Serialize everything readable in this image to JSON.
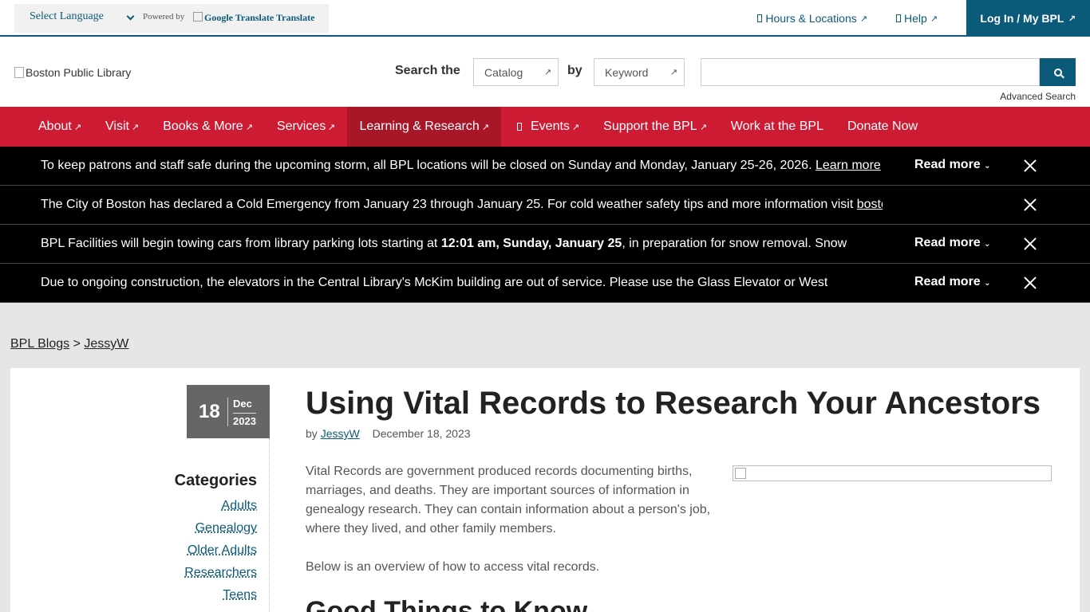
{
  "translate": {
    "select_label": "Select Language",
    "powered_by": "Powered by",
    "google_translate": "Google Translate",
    "translate": "Translate"
  },
  "toplinks": {
    "hours": "Hours & Locations",
    "help": "Help",
    "login": "Log In / My BPL"
  },
  "header": {
    "logo_alt": "Boston Public Library",
    "search_the": "Search the",
    "catalog": "Catalog",
    "by": "by",
    "keyword": "Keyword",
    "search_placeholder": "",
    "advanced": "Advanced Search"
  },
  "nav": [
    {
      "label": "About"
    },
    {
      "label": "Visit"
    },
    {
      "label": "Books & More"
    },
    {
      "label": "Services"
    },
    {
      "label": "Learning & Research"
    },
    {
      "label": "Events"
    },
    {
      "label": "Support the BPL"
    },
    {
      "label": "Work at the BPL"
    },
    {
      "label": "Donate Now"
    }
  ],
  "alerts": {
    "a1": {
      "text": "To keep patrons and staff safe during the upcoming storm, all BPL locations will be closed on Sunday and Monday, January 25-26, 2026. ",
      "link": "Learn more",
      "more": "Read more"
    },
    "a2": {
      "text": "The City of Boston has declared a Cold Emergency from January 23 through January 25. For cold weather safety tips and more information visit ",
      "link": "boston.gov/cold"
    },
    "a3": {
      "text_before": "BPL Facilities will begin towing cars from library parking lots starting at ",
      "bold": "12:01 am, Sunday, January 25",
      "text_after": ", in preparation for snow removal. Snow",
      "more": "Read more"
    },
    "a4": {
      "text": "Due to ongoing construction, the elevators in the Central Library's McKim building are out of service. Please use the Glass Elevator or West",
      "more": "Read more"
    }
  },
  "breadcrumb": {
    "root": "BPL Blogs",
    "sep": ">",
    "current": "JessyW"
  },
  "post": {
    "day": "18",
    "month": "Dec",
    "year": "2023",
    "title": "Using Vital Records to Research Your Ancestors",
    "by": "by",
    "author": "JessyW",
    "date": "December 18, 2023",
    "p1": "Vital Records are government produced records documenting births, marriages, and deaths. They are important sources of information in genealogy research. They can contain information about a person's job, where they lived, and other family members.",
    "p2": "Below is an overview of how to access vital records.",
    "h2": "Good Things to Know"
  },
  "categories": {
    "title": "Categories",
    "items": [
      "Adults",
      "Genealogy",
      "Older Adults",
      "Researchers",
      "Teens"
    ]
  },
  "colors": {
    "teal": "#0c5a79",
    "red": "#cc1b32",
    "alert_bg": "#000000"
  }
}
